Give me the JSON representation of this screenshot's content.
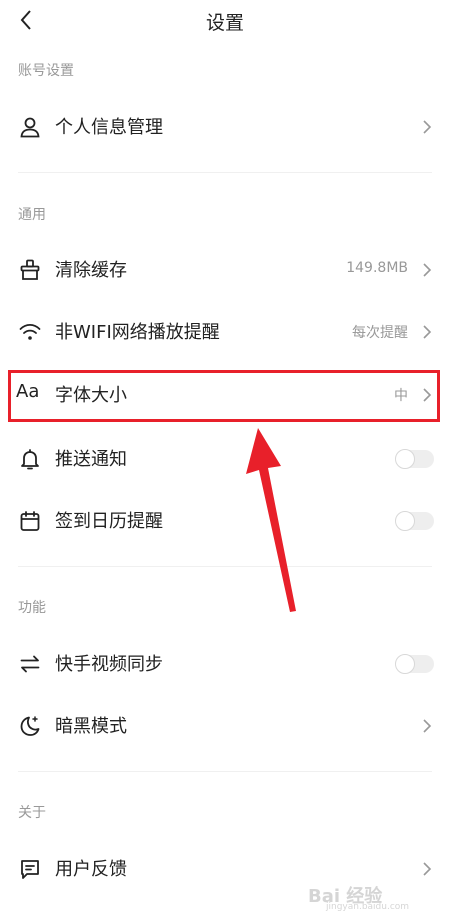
{
  "header": {
    "title": "设置"
  },
  "sections": {
    "account": {
      "title": "账号设置"
    },
    "general": {
      "title": "通用"
    },
    "features": {
      "title": "功能"
    },
    "about": {
      "title": "关于"
    }
  },
  "rows": {
    "profile": {
      "label": "个人信息管理",
      "icon": "user-icon"
    },
    "clear_cache": {
      "label": "清除缓存",
      "value": "149.8MB",
      "icon": "broom-icon"
    },
    "non_wifi": {
      "label": "非WIFI网络播放提醒",
      "value": "每次提醒",
      "icon": "wifi-icon"
    },
    "font_size": {
      "label": "字体大小",
      "value": "中",
      "icon_text": "Aa",
      "icon": "font-icon"
    },
    "push": {
      "label": "推送通知",
      "icon": "bell-icon",
      "toggle_on": false
    },
    "calendar": {
      "label": "签到日历提醒",
      "icon": "calendar-icon",
      "toggle_on": false
    },
    "kuaishou_sync": {
      "label": "快手视频同步",
      "icon": "swap-icon",
      "toggle_on": false
    },
    "dark_mode": {
      "label": "暗黑模式",
      "icon": "moon-icon"
    },
    "feedback": {
      "label": "用户反馈",
      "icon": "feedback-icon"
    }
  },
  "annotation": {
    "color": "#e8202a"
  },
  "watermark": {
    "text": "Bai 经验",
    "sub": "jingyan.baidu.com"
  }
}
